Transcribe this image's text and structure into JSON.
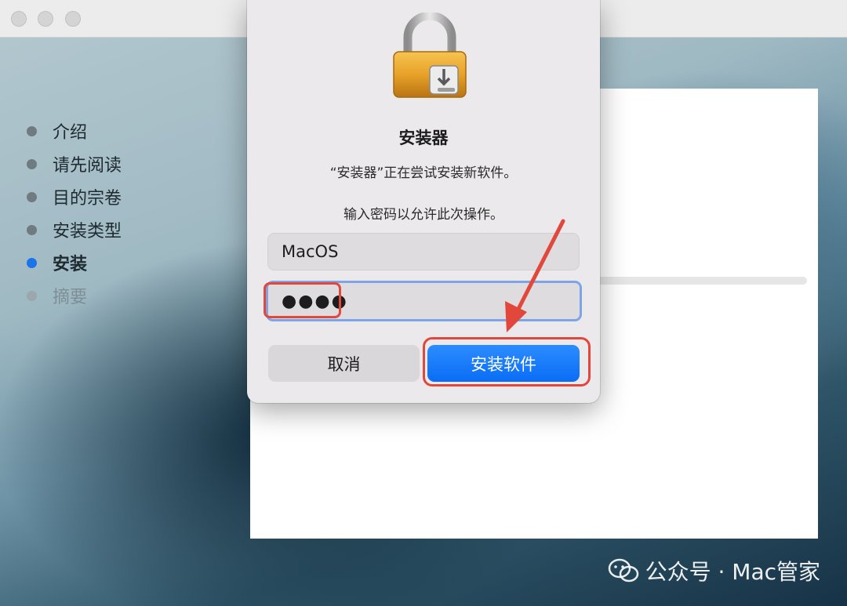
{
  "installer": {
    "steps": [
      {
        "label": "介绍",
        "state": "done"
      },
      {
        "label": "请先阅读",
        "state": "done"
      },
      {
        "label": "目的宗卷",
        "state": "done"
      },
      {
        "label": "安装类型",
        "state": "done"
      },
      {
        "label": "安装",
        "state": "active"
      },
      {
        "label": "摘要",
        "state": "pending"
      }
    ]
  },
  "dialog": {
    "title": "安装器",
    "message": "“安装器”正在尝试安装新软件。",
    "prompt": "输入密码以允许此次操作。",
    "username_value": "MacOS",
    "password_mask": "●●●●",
    "cancel_label": "取消",
    "install_label": "安装软件"
  },
  "watermark": {
    "text": "公众号 · Mac管家"
  },
  "colors": {
    "accent": "#0a6df4",
    "highlight": "#e2473b",
    "active_step": "#1a73e8"
  },
  "icons": [
    "lock-icon",
    "wechat-icon"
  ]
}
